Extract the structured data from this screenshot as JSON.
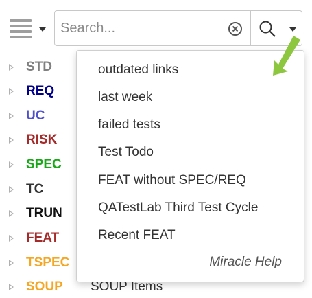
{
  "toolbar": {
    "search": {
      "placeholder": "Search..."
    }
  },
  "icons": {
    "menu": "hamburger-menu-icon",
    "clear": "clear-circle-x-icon",
    "search": "magnifier-icon",
    "dropdown": "chevron-down-icon",
    "expander": "triangle-right-icon",
    "hint": "green-arrow-icon"
  },
  "colors": {
    "STD": "#808080",
    "REQ": "#00008b",
    "UC": "#5050cc",
    "RISK": "#a52a2a",
    "SPEC": "#18a818",
    "TC": "#333333",
    "TRUN": "#111111",
    "FEAT": "#a52a2a",
    "TSPEC": "#f5a623",
    "SOUP": "#f5a623",
    "hint_arrow": "#8dc63f"
  },
  "tree": {
    "items": [
      {
        "label": "STD",
        "desc": ""
      },
      {
        "label": "REQ",
        "desc": ""
      },
      {
        "label": "UC",
        "desc": ""
      },
      {
        "label": "RISK",
        "desc": ""
      },
      {
        "label": "SPEC",
        "desc": ""
      },
      {
        "label": "TC",
        "desc": ""
      },
      {
        "label": "TRUN",
        "desc": ""
      },
      {
        "label": "FEAT",
        "desc": ""
      },
      {
        "label": "TSPEC",
        "desc": ""
      },
      {
        "label": "SOUP",
        "desc": "SOUP Items"
      }
    ]
  },
  "dropdown": {
    "items": [
      "outdated links",
      "last week",
      "failed tests",
      "Test Todo",
      "FEAT without SPEC/REQ",
      "QATestLab Third Test Cycle",
      "Recent FEAT"
    ],
    "help": "Miracle Help"
  }
}
